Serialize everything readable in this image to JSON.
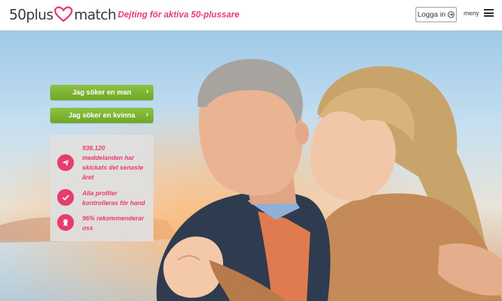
{
  "header": {
    "logo_left": "50plus",
    "logo_right": "match",
    "tagline": "Dejting för aktiva 50-plussare",
    "login_label": "Logga in",
    "menu_label": "meny"
  },
  "cta": {
    "man_label": "Jag söker en man",
    "woman_label": "Jag söker en kvinna"
  },
  "info": {
    "items": [
      {
        "icon": "paper-plane-icon",
        "text": "936.120 meddelanden har skickats det senaste året"
      },
      {
        "icon": "checkmark-icon",
        "text": "Alla profiler kontrolleras för hand"
      },
      {
        "icon": "award-ribbon-icon",
        "text": "96% rekommenderar oss"
      }
    ]
  },
  "colors": {
    "brand_pink": "#e73d6c",
    "cta_green": "#7bb431",
    "logo_gray": "#3a3a3a"
  }
}
